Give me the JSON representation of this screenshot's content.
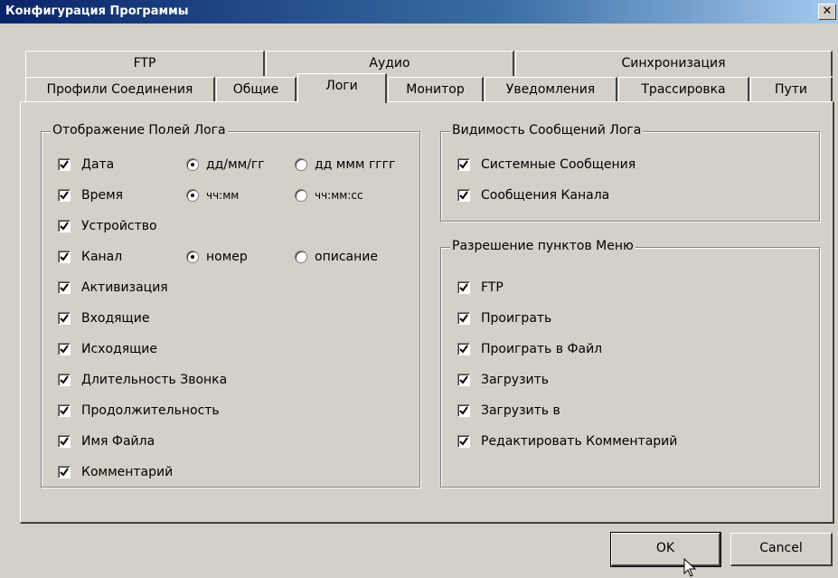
{
  "window": {
    "title": "Конфигурация Программы",
    "close_glyph": "✕"
  },
  "tabs_back": [
    "FTP",
    "Аудио",
    "Синхронизация"
  ],
  "tabs_front": [
    "Профили Соединения",
    "Общие",
    "Логи",
    "Монитор",
    "Уведомления",
    "Трассировка",
    "Пути"
  ],
  "active_tab": "Логи",
  "log_fields": {
    "title": "Отображение Полей Лога",
    "date": {
      "label": "Дата",
      "opt1": "дд/мм/гг",
      "opt2": "дд ммм гггг"
    },
    "time": {
      "label": "Время",
      "opt1": "чч:мм",
      "opt2": "чч:мм:сс"
    },
    "device": "Устройство",
    "channel": {
      "label": "Канал",
      "opt1": "номер",
      "opt2": "описание"
    },
    "items": [
      "Активизация",
      "Входящие",
      "Исходящие",
      "Длительность Звонка",
      "Продолжительность",
      "Имя Файла",
      "Комментарий"
    ]
  },
  "visibility": {
    "title": "Видимость Сообщений Лога",
    "items": [
      "Системные Сообщения",
      "Сообщения Канала"
    ]
  },
  "menu": {
    "title": "Разрешение пунктов Меню",
    "items": [
      "FTP",
      "Проиграть",
      "Проиграть в Файл",
      "Загрузить",
      "Загрузить в",
      "Редактировать Комментарий"
    ]
  },
  "buttons": {
    "ok": "OK",
    "cancel": "Cancel"
  }
}
